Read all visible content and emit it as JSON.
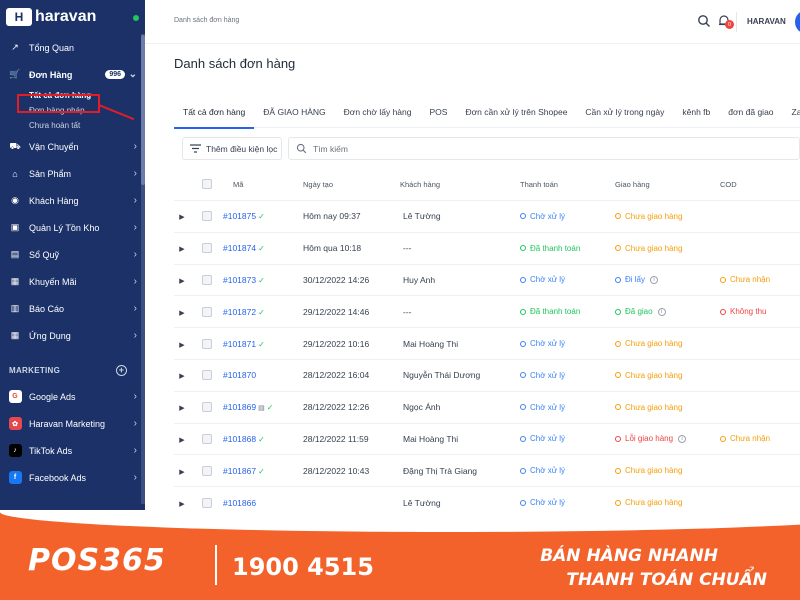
{
  "brand": {
    "name": "haravan",
    "mark": "H"
  },
  "sidebar": {
    "items": [
      {
        "label": "Tổng Quan",
        "icon": "chart-line-icon"
      },
      {
        "label": "Đơn Hàng",
        "icon": "cart-icon",
        "badge": "996"
      },
      {
        "label": "Vận Chuyển",
        "icon": "truck-icon"
      },
      {
        "label": "Sản Phẩm",
        "icon": "tag-icon"
      },
      {
        "label": "Khách Hàng",
        "icon": "user-icon"
      },
      {
        "label": "Quản Lý Tồn Kho",
        "icon": "box-icon"
      },
      {
        "label": "Sổ Quỹ",
        "icon": "wallet-icon"
      },
      {
        "label": "Khuyến Mãi",
        "icon": "gift-icon"
      },
      {
        "label": "Báo Cáo",
        "icon": "report-icon"
      },
      {
        "label": "Ứng Dụng",
        "icon": "apps-icon"
      }
    ],
    "order_subitems": [
      "Tất cả đơn hàng",
      "Đơn hàng nháp",
      "Chưa hoàn tất"
    ],
    "marketing_title": "MARKETING",
    "marketing": [
      {
        "label": "Google Ads",
        "icon": "google-icon",
        "icon_text": "G",
        "color": "#ffffff",
        "text_color": "#ea4335"
      },
      {
        "label": "Haravan Marketing",
        "icon": "haravan-marketing-icon",
        "icon_text": "✿",
        "color": "#e5484d",
        "text_color": "#ffffff"
      },
      {
        "label": "TikTok Ads",
        "icon": "tiktok-icon",
        "icon_text": "♪",
        "color": "#000000",
        "text_color": "#ffffff"
      },
      {
        "label": "Facebook Ads",
        "icon": "facebook-icon",
        "icon_text": "f",
        "color": "#1877f2",
        "text_color": "#ffffff"
      }
    ]
  },
  "header": {
    "breadcrumb": "Danh sách đơn hàng",
    "store": "HARAVAN",
    "notif_count": "0"
  },
  "page_title": "Danh sách đơn hàng",
  "tabs": [
    "Tất cả đơn hàng",
    "ĐÃ GIAO HÀNG",
    "Đơn chờ lấy hàng",
    "POS",
    "Đơn cần xử lý trên Shopee",
    "Cần xử lý trong ngày",
    "kênh fb",
    "đơn đã giao",
    "Zalo"
  ],
  "filter": {
    "label": "Thêm điều kiện lọc",
    "search_placeholder": "Tìm kiếm"
  },
  "columns": [
    "Mã",
    "Ngày tạo",
    "Khách hàng",
    "Thanh toán",
    "Giao hàng",
    "COD"
  ],
  "status_colors": {
    "blue": "#3b82f6",
    "green": "#22c55e",
    "orange": "#f59e0b",
    "red": "#ef4444"
  },
  "rows": [
    {
      "code": "#101875",
      "tick": true,
      "doc": false,
      "date": "Hôm nay 09:37",
      "customer": "Lê Tường",
      "payment": "Chờ xử lý",
      "pay_color": "#3b82f6",
      "shipping": "Chưa giao hàng",
      "ship_color": "#f59e0b",
      "ship_info": false,
      "cod": "",
      "cod_color": ""
    },
    {
      "code": "#101874",
      "tick": true,
      "doc": false,
      "date": "Hôm qua 10:18",
      "customer": "---",
      "payment": "Đã thanh toán",
      "pay_color": "#22c55e",
      "shipping": "Chưa giao hàng",
      "ship_color": "#f59e0b",
      "ship_info": false,
      "cod": "",
      "cod_color": ""
    },
    {
      "code": "#101873",
      "tick": true,
      "doc": false,
      "date": "30/12/2022 14:26",
      "customer": "Huy Anh",
      "payment": "Chờ xử lý",
      "pay_color": "#3b82f6",
      "shipping": "Đi lấy",
      "ship_color": "#3b82f6",
      "ship_info": true,
      "cod": "Chưa nhận",
      "cod_color": "#f59e0b"
    },
    {
      "code": "#101872",
      "tick": true,
      "doc": false,
      "date": "29/12/2022 14:46",
      "customer": "---",
      "payment": "Đã thanh toán",
      "pay_color": "#22c55e",
      "shipping": "Đã giao",
      "ship_color": "#22c55e",
      "ship_info": true,
      "cod": "Không thu",
      "cod_color": "#ef4444"
    },
    {
      "code": "#101871",
      "tick": true,
      "doc": false,
      "date": "29/12/2022 10:16",
      "customer": "Mai Hoàng Thi",
      "payment": "Chờ xử lý",
      "pay_color": "#3b82f6",
      "shipping": "Chưa giao hàng",
      "ship_color": "#f59e0b",
      "ship_info": false,
      "cod": "",
      "cod_color": ""
    },
    {
      "code": "#101870",
      "tick": false,
      "doc": false,
      "date": "28/12/2022 16:04",
      "customer": "Nguyễn Thái Dương",
      "payment": "Chờ xử lý",
      "pay_color": "#3b82f6",
      "shipping": "Chưa giao hàng",
      "ship_color": "#f59e0b",
      "ship_info": false,
      "cod": "",
      "cod_color": ""
    },
    {
      "code": "#101869",
      "tick": true,
      "doc": true,
      "date": "28/12/2022 12:26",
      "customer": "Ngọc Ánh",
      "payment": "Chờ xử lý",
      "pay_color": "#3b82f6",
      "shipping": "Chưa giao hàng",
      "ship_color": "#f59e0b",
      "ship_info": false,
      "cod": "",
      "cod_color": ""
    },
    {
      "code": "#101868",
      "tick": true,
      "doc": false,
      "date": "28/12/2022 11:59",
      "customer": "Mai Hoàng Thi",
      "payment": "Chờ xử lý",
      "pay_color": "#3b82f6",
      "shipping": "Lỗi giao hàng",
      "ship_color": "#ef4444",
      "ship_info": true,
      "cod": "Chưa nhận",
      "cod_color": "#f59e0b"
    },
    {
      "code": "#101867",
      "tick": true,
      "doc": false,
      "date": "28/12/2022 10:43",
      "customer": "Đặng Thị Trà Giang",
      "payment": "Chờ xử lý",
      "pay_color": "#3b82f6",
      "shipping": "Chưa giao hàng",
      "ship_color": "#f59e0b",
      "ship_info": false,
      "cod": "",
      "cod_color": ""
    },
    {
      "code": "#101866",
      "tick": false,
      "doc": false,
      "date": "",
      "customer": "Lê Tường",
      "payment": "Chờ xử lý",
      "pay_color": "#3b82f6",
      "shipping": "Chưa giao hàng",
      "ship_color": "#f59e0b",
      "ship_info": false,
      "cod": "",
      "cod_color": ""
    }
  ],
  "banner": {
    "logo": "POS365",
    "phone": "1900 4515",
    "slogan1": "BÁN HÀNG NHANH",
    "slogan2": "THANH TOÁN CHUẨN"
  }
}
